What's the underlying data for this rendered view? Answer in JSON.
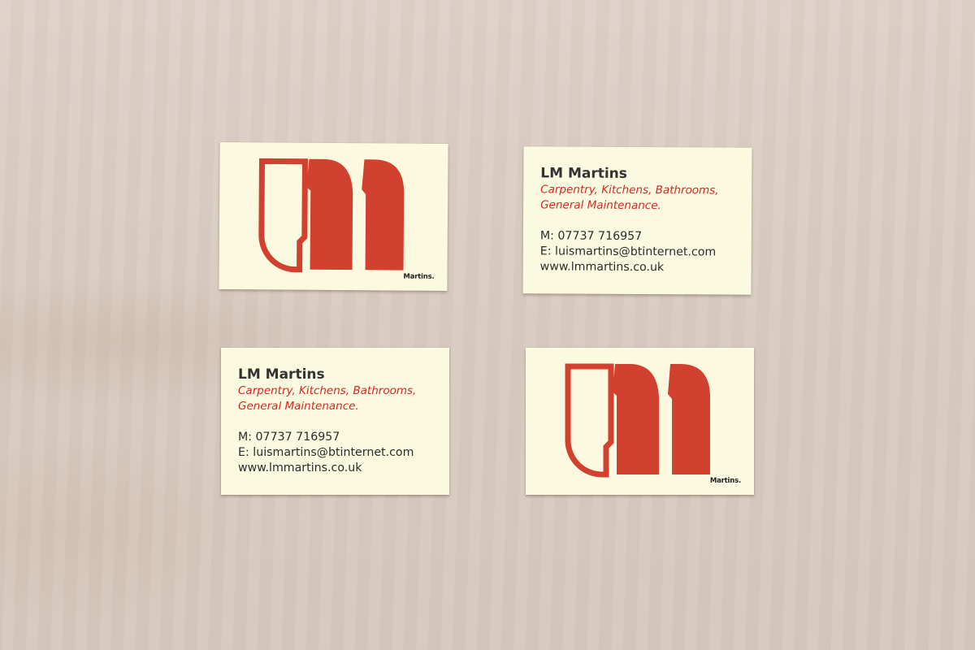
{
  "brand_color": "#d2402f",
  "logo": {
    "monogram": "lm",
    "wordmark": "Martins."
  },
  "contact_card": {
    "name": "LM Martins",
    "services": [
      "Carpentry, Kitchens, Bathrooms,",
      "General Maintenance."
    ],
    "mobile": "M: 07737 716957",
    "email": "E: luismartins@btinternet.com",
    "website": "www.lmmartins.co.uk"
  }
}
